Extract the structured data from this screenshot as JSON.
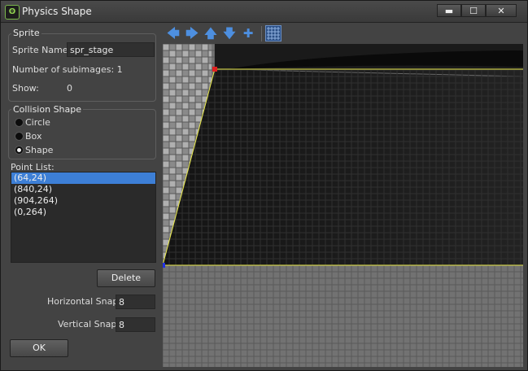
{
  "window": {
    "title": "Physics Shape",
    "app_icon": "gm-logo-icon"
  },
  "title_buttons": {
    "minimize": "▬",
    "maximize": "☐",
    "close": "✕"
  },
  "sprite_group": {
    "legend": "Sprite",
    "name_label": "Sprite Name:",
    "name_value": "spr_stage",
    "subimages_label": "Number of subimages: 1",
    "show_label": "Show:",
    "show_value": "0"
  },
  "collision_group": {
    "legend": "Collision Shape",
    "options": [
      "Circle",
      "Box",
      "Shape"
    ],
    "selected": "Shape"
  },
  "point_list": {
    "label": "Point List:",
    "items": [
      "(64,24)",
      "(840,24)",
      "(904,264)",
      "(0,264)"
    ],
    "selected_index": 0
  },
  "delete_label": "Delete",
  "horizontal_snap": {
    "label": "Horizontal Snap:",
    "value": "8"
  },
  "vertical_snap": {
    "label": "Vertical Snap:",
    "value": "8"
  },
  "ok_label": "OK",
  "toolbar": {
    "left_arrow": "🡄",
    "right_arrow": "🡆",
    "up_arrow": "🡅",
    "down_arrow": "🡇",
    "center": "✚"
  },
  "colors": {
    "accent": "#3d7fd6",
    "shape_edge": "#e8e84a",
    "point_selected": "#e02020",
    "point": "#2030e0"
  }
}
